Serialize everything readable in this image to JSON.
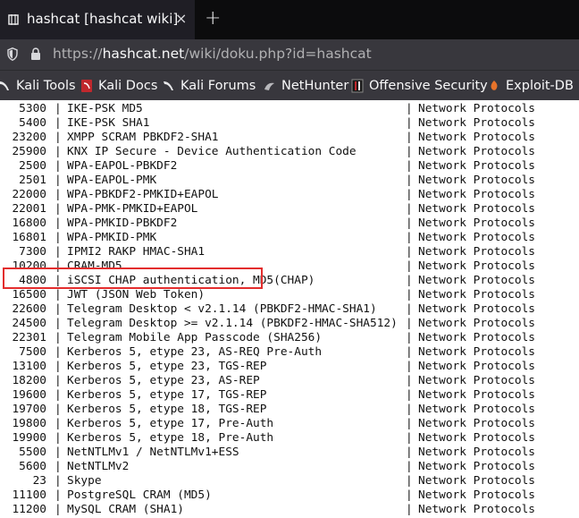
{
  "tab": {
    "title": "hashcat [hashcat wiki]",
    "close": "×",
    "new_tab": "+"
  },
  "address": {
    "protocol": "https://",
    "host": "hashcat.net",
    "path": "/wiki/doku.php?id=hashcat"
  },
  "bookmarks": [
    {
      "label": "Kali Tools",
      "icon": "kali-dragon-icon"
    },
    {
      "label": "Kali Docs",
      "icon": "kali-docs-icon"
    },
    {
      "label": "Kali Forums",
      "icon": "kali-dragon-icon"
    },
    {
      "label": "NetHunter",
      "icon": "nethunter-icon"
    },
    {
      "label": "Offensive Security",
      "icon": "offsec-icon"
    },
    {
      "label": "Exploit-DB",
      "icon": "exploit-db-icon"
    }
  ],
  "table": {
    "separator": "|",
    "rows": [
      {
        "mode": "5300",
        "name": "IKE-PSK MD5",
        "category": "Network Protocols"
      },
      {
        "mode": "5400",
        "name": "IKE-PSK SHA1",
        "category": "Network Protocols"
      },
      {
        "mode": "23200",
        "name": "XMPP SCRAM PBKDF2-SHA1",
        "category": "Network Protocols"
      },
      {
        "mode": "25900",
        "name": "KNX IP Secure - Device Authentication Code",
        "category": "Network Protocols"
      },
      {
        "mode": "2500",
        "name": "WPA-EAPOL-PBKDF2",
        "category": "Network Protocols"
      },
      {
        "mode": "2501",
        "name": "WPA-EAPOL-PMK",
        "category": "Network Protocols"
      },
      {
        "mode": "22000",
        "name": "WPA-PBKDF2-PMKID+EAPOL",
        "category": "Network Protocols"
      },
      {
        "mode": "22001",
        "name": "WPA-PMK-PMKID+EAPOL",
        "category": "Network Protocols"
      },
      {
        "mode": "16800",
        "name": "WPA-PMKID-PBKDF2",
        "category": "Network Protocols"
      },
      {
        "mode": "16801",
        "name": "WPA-PMKID-PMK",
        "category": "Network Protocols"
      },
      {
        "mode": "7300",
        "name": "IPMI2 RAKP HMAC-SHA1",
        "category": "Network Protocols"
      },
      {
        "mode": "10200",
        "name": "CRAM-MD5",
        "category": "Network Protocols"
      },
      {
        "mode": "4800",
        "name": "iSCSI CHAP authentication, MD5(CHAP)",
        "category": "Network Protocols"
      },
      {
        "mode": "16500",
        "name": "JWT (JSON Web Token)",
        "category": "Network Protocols"
      },
      {
        "mode": "22600",
        "name": "Telegram Desktop < v2.1.14 (PBKDF2-HMAC-SHA1)",
        "category": "Network Protocols"
      },
      {
        "mode": "24500",
        "name": "Telegram Desktop >= v2.1.14 (PBKDF2-HMAC-SHA512)",
        "category": "Network Protocols"
      },
      {
        "mode": "22301",
        "name": "Telegram Mobile App Passcode (SHA256)",
        "category": "Network Protocols"
      },
      {
        "mode": "7500",
        "name": "Kerberos 5, etype 23, AS-REQ Pre-Auth",
        "category": "Network Protocols"
      },
      {
        "mode": "13100",
        "name": "Kerberos 5, etype 23, TGS-REP",
        "category": "Network Protocols"
      },
      {
        "mode": "18200",
        "name": "Kerberos 5, etype 23, AS-REP",
        "category": "Network Protocols"
      },
      {
        "mode": "19600",
        "name": "Kerberos 5, etype 17, TGS-REP",
        "category": "Network Protocols"
      },
      {
        "mode": "19700",
        "name": "Kerberos 5, etype 18, TGS-REP",
        "category": "Network Protocols"
      },
      {
        "mode": "19800",
        "name": "Kerberos 5, etype 17, Pre-Auth",
        "category": "Network Protocols"
      },
      {
        "mode": "19900",
        "name": "Kerberos 5, etype 18, Pre-Auth",
        "category": "Network Protocols"
      },
      {
        "mode": "5500",
        "name": "NetNTLMv1 / NetNTLMv1+ESS",
        "category": "Network Protocols"
      },
      {
        "mode": "5600",
        "name": "NetNTLMv2",
        "category": "Network Protocols"
      },
      {
        "mode": "23",
        "name": "Skype",
        "category": "Network Protocols"
      },
      {
        "mode": "11100",
        "name": "PostgreSQL CRAM (MD5)",
        "category": "Network Protocols"
      },
      {
        "mode": "11200",
        "name": "MySQL CRAM (SHA1)",
        "category": "Network Protocols"
      }
    ]
  },
  "highlight_color": "#e32d2d"
}
